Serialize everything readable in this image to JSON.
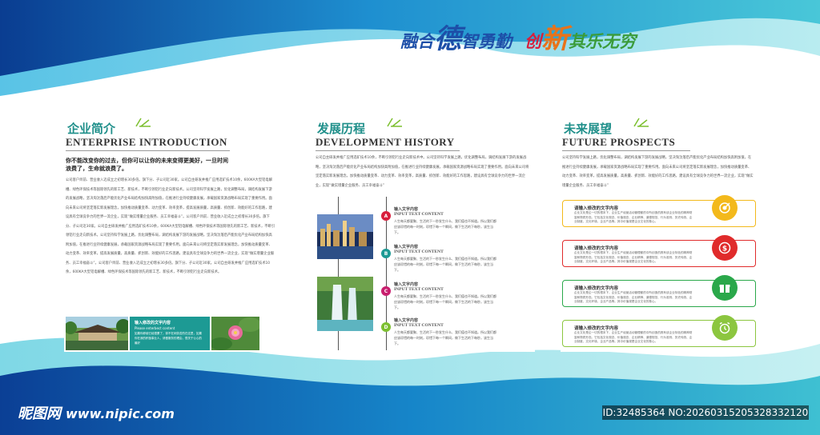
{
  "slogan": {
    "parts": [
      "融合",
      "德",
      "智勇勤",
      "创",
      "新",
      "其乐无穷"
    ]
  },
  "section1": {
    "title_cn": "企业简介",
    "title_en": "ENTERPRISE INTRODUCTION",
    "lead": "你不能改变你的过去，但你可以让你的未来变得更美好，一旦时间浪费了，生命就浪费了。",
    "body": "公司客户目前、营业收入近成立之初增长30多倍。旗下分、子公司近30家。公司自主研发并推广应用选矿技术10余，600KA大型铝电解槽、绿色环保技术等国际领先的新工艺、新技术，不断引领铝行业走向新技术。公司坚持科学发展上路，优化调整布局，调结构发展下游的发展战略，坚决淘汰落后产能优化产业布局结构加快高附加值，在推进行业持续健康发展，承载国家资源战略布局实现了重要作用。面向未来公司将坚定落实新发展理念，加快推动质量变革、动力变革、效率变革，提高发展质量，高质量、抓创新、效能好的工作思路，建设具有全球竞争力的世界一流企业，实现“做实增量企业服务、员工幸福奋斗”。公司客户目前、营业收入近成立之初增长30多倍。旗下分、子公司近30家。公司自主研发并推广应用选矿技术10余，600KA大型铝电解槽、绿色环保技术等国际领先的新工艺、新技术，不断引领铝行业走向新技术。公司坚持科学发展上路，优化调整布局，调结构发展下游的发展战略，坚决淘汰落后产能优化产业布局结构加快高附加值，在推进行业持续健康发展，承载国家资源战略布局实现了重要作用。面向未来公司将坚定落实新发展理念，加快推动质量变革、动力变革、效率变革，提高发展质量，高质量、抓创新、效能好的工作思路，建设具有全球竞争力的世界一流企业，实现“做实增量企业服务、员工幸福奋斗”。公司客户目前、营业收入近成立之初增长30多倍。旗下分、子公司近30家。公司自主研发并推广应用选矿技术10余，600KA大型铝电解槽、绿色环保技术等国际领先的新工艺、新技术，不断引领铝行业走向新技术。",
    "box_title": "输入修改的文字内容",
    "box_sub": "Please enterbect content",
    "box_body": "如果你即使已经很累了，却不在闲劳苦的在这里，如果你在我的积极事业人，请做服务的理由，很关于公心的最好"
  },
  "section2": {
    "title_cn": "发展历程",
    "title_en": "DEVELOPMENT HISTORY",
    "intro": "公司自主研发并推广应用选矿技术10余，不断引领铝行业走向新技术中。公司坚持科学发展上路，优化调整布局，调结构发展下游的发展战略，坚决淘汰落后产能优化产业布局结构加快高附加值，在推进行业持续健康发展，承载国家资源战略布局实现了重要作用。面向未来公司将坚定落实新发展理念，加快推动质量变革、动力变革、效率变革，高质量、抓创新、效能好的工作思路，建设具有全球竞争力的世界一流企业，实现“做实增量企业服务、员工幸福奋斗”",
    "items": [
      {
        "badge": "A",
        "color": "#d81e3c",
        "title": "输入文字内容",
        "sub": "INPUT TEXT CONTENT",
        "body": "人生每天都要聚、生活的下一秒发生什么、我们值也不知道。所以我们都应该珍惜的每一时刻，珍惜下每一个瞬间，做下生活的下每秒，该生当下。"
      },
      {
        "badge": "B",
        "color": "#1d9a94",
        "title": "输入文字内容",
        "sub": "INPUT TEXT CONTENT",
        "body": "人生每天都要聚、生活的下一秒发生什么、我们值也不知道。所以我们都应该珍惜的每一时刻，珍惜下每一个瞬间，做下生活的下每秒，该生当下。"
      },
      {
        "badge": "C",
        "color": "#c81f6e",
        "title": "输入文字内容",
        "sub": "INPUT TEXT CONTENT",
        "body": "人生每天都要聚、生活的下一秒发生什么、我们值也不知道。所以我们都应该珍惜的每一时刻，珍惜下每一个瞬间，做下生活的下每秒，该生当下。"
      },
      {
        "badge": "D",
        "color": "#7cbf2f",
        "title": "输入文字内容",
        "sub": "INPUT TEXT CONTENT",
        "body": "人生每天都要聚、生活的下一秒发生什么、我们值也不知道。所以我们都应该珍惜的每一时刻，珍惜下每一个瞬间，做下生活的下每秒，该生当下。"
      }
    ]
  },
  "section3": {
    "title_cn": "未来展望",
    "title_en": "FUTURE PROSPECTS",
    "intro": "公司坚持科学发展上路，优化调整布局，调结构发展下游的发展战略，坚决淘汰落后产能优化产业布局结构加快高附加值，在推进行业持续健康发展，承载国家资源战略布局实现了重要作用。面向未来公司将坚定落实新发展理念，加快推动质量变革、动力变革、效率变革，提高发展质量，高质量、抓创新、效能好的工作思路，建设具有全球竞争力的世界一流企业，实现“做实增量企业服务、员工幸福奋斗”",
    "cards": [
      {
        "title": "请输入修改的文字内容",
        "body": "企业文化是企一切的根本下，企业生产经营活动管理都的中所创造的具有该企业特色的精神财富和物质形态。它包括文化观念、价值观念、企业精神、道德规范、行为准则、历史传统、企业制度、文化环境、企业产品等。其中价值观是企业文化的核心。",
        "color": "#f3b91b",
        "icon": "target-icon"
      },
      {
        "title": "请输入修改的文字内容",
        "body": "企业文化是企一切的根本下，企业生产经营活动管理都的中所创造的具有该企业特色的精神财富和物质形态。它包括文化观念、价值观念、企业精神、道德规范、行为准则、历史传统、企业制度、文化环境、企业产品等。其中价值观是企业文化的核心。",
        "color": "#e02b2b",
        "icon": "dollar-icon"
      },
      {
        "title": "请输入修改的文字内容",
        "body": "企业文化是企一切的根本下，企业生产经营活动管理都的中所创造的具有该企业特色的精神财富和物质形态。它包括文化观念、价值观念、企业精神、道德规范、行为准则、历史传统、企业制度、文化环境、企业产品等。其中价值观是企业文化的核心。",
        "color": "#2aa84a",
        "icon": "gift-icon"
      },
      {
        "title": "请输入修改的文字内容",
        "body": "企业文化是企一切的根本下，企业生产经营活动管理都的中所创造的具有该企业特色的精神财富和物质形态。它包括文化观念、价值观念、企业精神、道德规范、行为准则、历史传统、企业制度、文化环境、企业产品等。其中价值观是企业文化的核心。",
        "color": "#8cc63f",
        "icon": "alarm-clock-icon"
      }
    ]
  },
  "watermark": {
    "site_name": "昵图网",
    "url": "www.nipic.com",
    "id_text": "ID:32485364 NO:20260315205328332120"
  }
}
